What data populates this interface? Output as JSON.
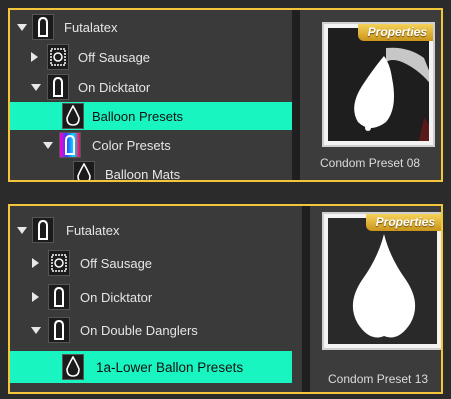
{
  "top": {
    "tree": [
      {
        "label": "Futalatex",
        "expander": "down",
        "icon": "condom-icon"
      },
      {
        "label": "Off Sausage",
        "expander": "right",
        "icon": "package-icon"
      },
      {
        "label": "On Dicktator",
        "expander": "down",
        "icon": "condom-icon"
      },
      {
        "label": "Balloon Presets",
        "expander": "none",
        "icon": "balloon-icon",
        "selected": true
      },
      {
        "label": "Color Presets",
        "expander": "down",
        "icon": "color-swatch-icon"
      },
      {
        "label": "Balloon Mats",
        "expander": "none",
        "icon": "balloon-icon"
      }
    ],
    "preview": {
      "badge": "Properties",
      "caption": "Condom Preset 08"
    }
  },
  "bottom": {
    "tree": [
      {
        "label": "Futalatex",
        "expander": "down",
        "icon": "condom-icon"
      },
      {
        "label": "Off Sausage",
        "expander": "right",
        "icon": "package-icon"
      },
      {
        "label": "On Dicktator",
        "expander": "right",
        "icon": "condom-icon"
      },
      {
        "label": "On Double Danglers",
        "expander": "down",
        "icon": "condom-icon"
      },
      {
        "label": "1a-Lower Ballon Presets",
        "expander": "none",
        "icon": "balloon-icon",
        "selected": true
      }
    ],
    "preview": {
      "badge": "Properties",
      "caption": "Condom Preset 13"
    }
  },
  "colors": {
    "highlight": "#19f5c0",
    "border": "#f2c53a",
    "badge": "#e0b030"
  }
}
